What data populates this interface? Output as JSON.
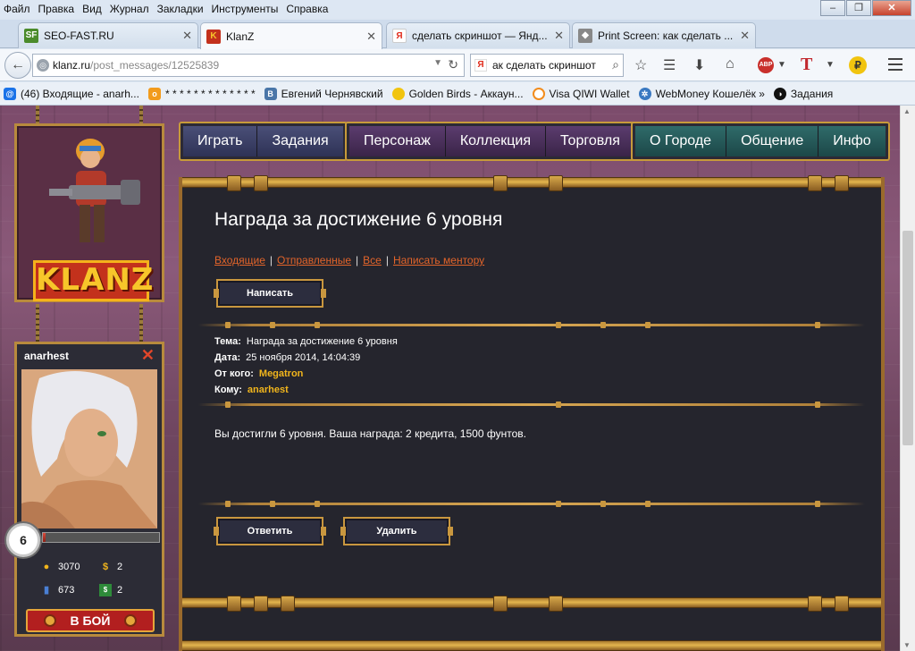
{
  "browser": {
    "menu": [
      "Файл",
      "Правка",
      "Вид",
      "Журнал",
      "Закладки",
      "Инструменты",
      "Справка"
    ],
    "tabs": [
      {
        "title": "SEO-FAST.RU",
        "favicon": "SF"
      },
      {
        "title": "KlanZ",
        "favicon": "K"
      },
      {
        "title": "сделать скриншот — Янд...",
        "favicon": "Я"
      },
      {
        "title": "Print Screen: как сделать ...",
        "favicon": "◆"
      }
    ],
    "url_host": "klanz.ru",
    "url_path": "/post_messages/12525839",
    "search_value": "ак сделать скриншот",
    "bookmarks": [
      {
        "label": "(46) Входящие - anarh...",
        "color": "#1a73e8",
        "icon": "mail-icon"
      },
      {
        "label": "* * * * * * * * * * * * *",
        "color": "#f29b1c",
        "icon": "odnoklassniki-icon"
      },
      {
        "label": "Евгений Чернявский",
        "color": "#4a76a8",
        "icon": "vk-icon"
      },
      {
        "label": "Golden Birds - Аккаун...",
        "color": "#f1c40f",
        "icon": "bird-icon"
      },
      {
        "label": "Visa QIWI Wallet",
        "color": "#f28c1c",
        "icon": "qiwi-icon"
      },
      {
        "label": "WebMoney Кошелёк »",
        "color": "#3a79c1",
        "icon": "webmoney-icon"
      },
      {
        "label": "Задания",
        "color": "#111111",
        "icon": "task-icon"
      }
    ]
  },
  "game": {
    "logo_text": "KLANZ",
    "nav_groups": [
      [
        "Играть",
        "Задания"
      ],
      [
        "Персонаж",
        "Коллекция",
        "Торговля"
      ],
      [
        "О Городе",
        "Общение",
        "Инфо"
      ]
    ],
    "player": {
      "name": "anarhest",
      "level": "6",
      "health_fraction": 0.02,
      "coins": "3070",
      "dollars": "2",
      "rating": "673",
      "tickets": "2",
      "fight_label": "В БОЙ"
    }
  },
  "message": {
    "page_title": "Награда за достижение 6 уровня",
    "links": [
      "Входящие",
      "Отправленные",
      "Все",
      "Написать ментору"
    ],
    "write_button": "Написать",
    "subject_label": "Тема:",
    "subject": "Награда за достижение 6 уровня",
    "date_label": "Дата:",
    "date": "25 ноября 2014, 14:04:39",
    "from_label": "От кого:",
    "from": "Megatron",
    "to_label": "Кому:",
    "to": "anarhest",
    "body": "Вы достигли 6 уровня. Ваша награда: 2 кредита, 1500 фунтов.",
    "reply_button": "Ответить",
    "delete_button": "Удалить"
  }
}
